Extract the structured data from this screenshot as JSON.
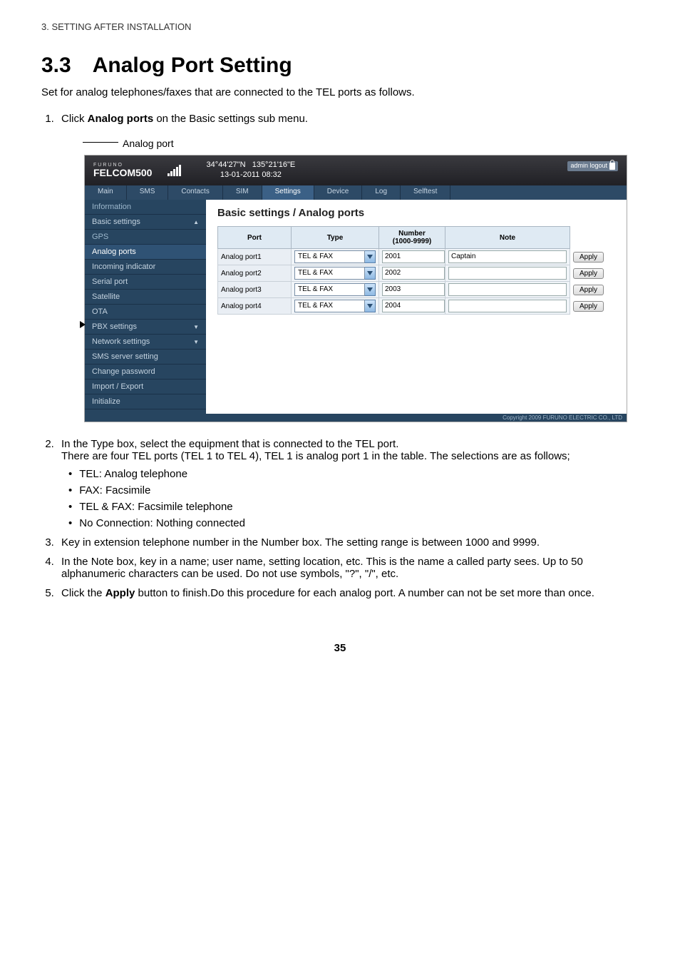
{
  "breadcrumb": "3.  SETTING AFTER INSTALLATION",
  "heading_num": "3.3",
  "heading_text": "Analog Port Setting",
  "intro": "Set for analog telephones/faxes that are connected to the TEL ports as follows.",
  "steps": {
    "s1_a": "Click ",
    "s1_b": "Analog ports",
    "s1_c": " on the Basic settings sub menu.",
    "s2_a": "In the Type box, select the equipment that is connected to the TEL port.",
    "s2_b": "There are four TEL ports (TEL 1 to TEL 4), TEL 1 is analog port 1 in the table. The selections are as follows;",
    "s2_opts": [
      "TEL: Analog telephone",
      "FAX: Facsimile",
      "TEL & FAX: Facsimile telephone",
      "No Connection: Nothing connected"
    ],
    "s3": "Key in extension telephone number in the Number box. The setting range is between 1000 and 9999.",
    "s4": "In the Note box, key in a name; user name, setting location, etc. This is the name a called party sees. Up to 50 alphanumeric characters can be used. Do not use symbols, \"?\", \"/\", etc.",
    "s5_a": "Click the ",
    "s5_b": "Apply",
    "s5_c": " button to finish.Do this procedure for each analog port. A number can not be set more than once."
  },
  "annot_label": "Analog port",
  "ui": {
    "brand_small": "FURUNO",
    "product": "FELCOM500",
    "lat": "34°44'27\"N",
    "lon": "135°21'16\"E",
    "datetime": "13-01-2011 08:32",
    "logout_label": "admin logout",
    "tabs": [
      "Main",
      "SMS",
      "Contacts",
      "SIM",
      "Settings",
      "Device",
      "Log",
      "Selftest"
    ],
    "active_tab": "Settings",
    "sidebar": [
      "Information",
      "Basic settings",
      "GPS",
      "Analog ports",
      "Incoming indicator",
      "Serial port",
      "Satellite",
      "OTA",
      "PBX settings",
      "Network settings",
      "SMS server setting",
      "Change password",
      "Import / Export",
      "Initialize"
    ],
    "content_title": "Basic settings / Analog ports",
    "headers": {
      "port": "Port",
      "type": "Type",
      "number": "Number\n(1000-9999)",
      "note": "Note"
    },
    "rows": [
      {
        "port": "Analog port1",
        "type": "TEL & FAX",
        "number": "2001",
        "note": "Captain"
      },
      {
        "port": "Analog port2",
        "type": "TEL & FAX",
        "number": "2002",
        "note": ""
      },
      {
        "port": "Analog port3",
        "type": "TEL & FAX",
        "number": "2003",
        "note": ""
      },
      {
        "port": "Analog port4",
        "type": "TEL & FAX",
        "number": "2004",
        "note": ""
      }
    ],
    "apply_label": "Apply",
    "footer": "Copyright 2009 FURUNO ELECTRIC CO., LTD"
  },
  "page_number": "35"
}
